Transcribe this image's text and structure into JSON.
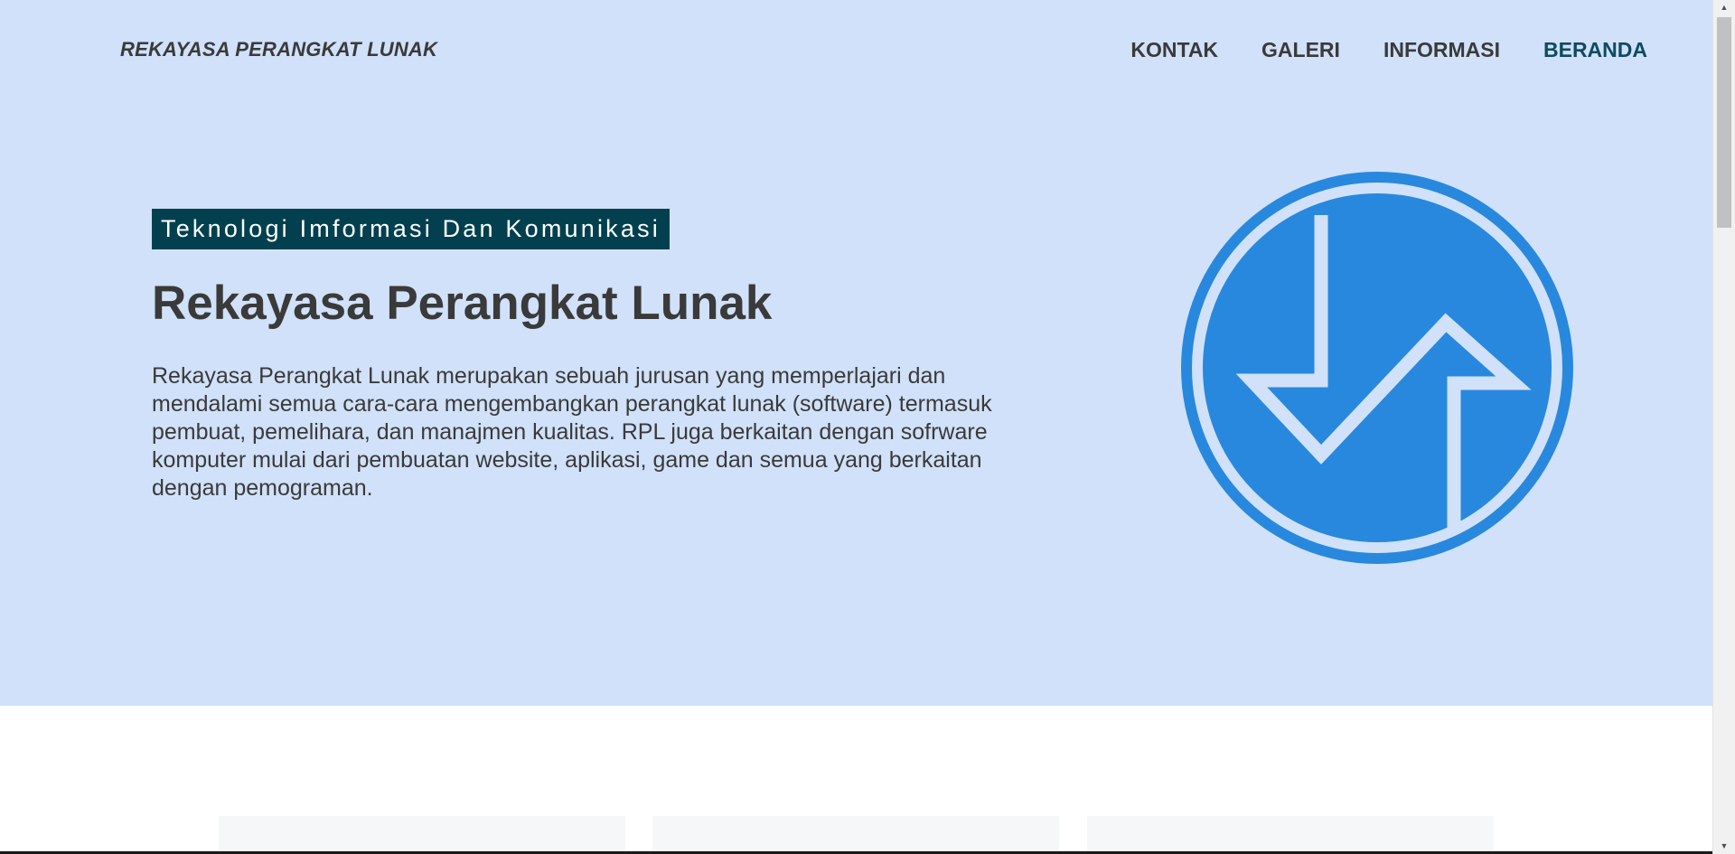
{
  "header": {
    "brand": "REKAYASA PERANGKAT LUNAK",
    "nav": [
      {
        "label": "KONTAK"
      },
      {
        "label": "GALERI"
      },
      {
        "label": "INFORMASI"
      },
      {
        "label": "BERANDA",
        "active": true
      }
    ]
  },
  "hero": {
    "tagline": "Teknologi Imformasi Dan Komunikasi",
    "title": "Rekayasa Perangkat Lunak",
    "description": "Rekayasa Perangkat Lunak merupakan sebuah jurusan yang memperlajari dan mendalami semua cara-cara mengembangkan perangkat lunak (software) termasuk pembuat, pemelihara, dan manajmen kualitas. RPL juga berkaitan dengan sofrware komputer mulai dari pembuatan website, aplikasi, game dan semua yang berkaitan dengan pemograman.",
    "logo_icon": "rpl-logo-icon"
  },
  "colors": {
    "hero_background": "#d0e1f9",
    "tagline_background": "#03404f",
    "logo_blue": "#2888de",
    "active_nav": "#0f4a60",
    "text": "#3a3a3a"
  },
  "scrollbar": {
    "up_icon": "scroll-up-arrow-icon",
    "down_icon": "scroll-down-arrow-icon"
  }
}
